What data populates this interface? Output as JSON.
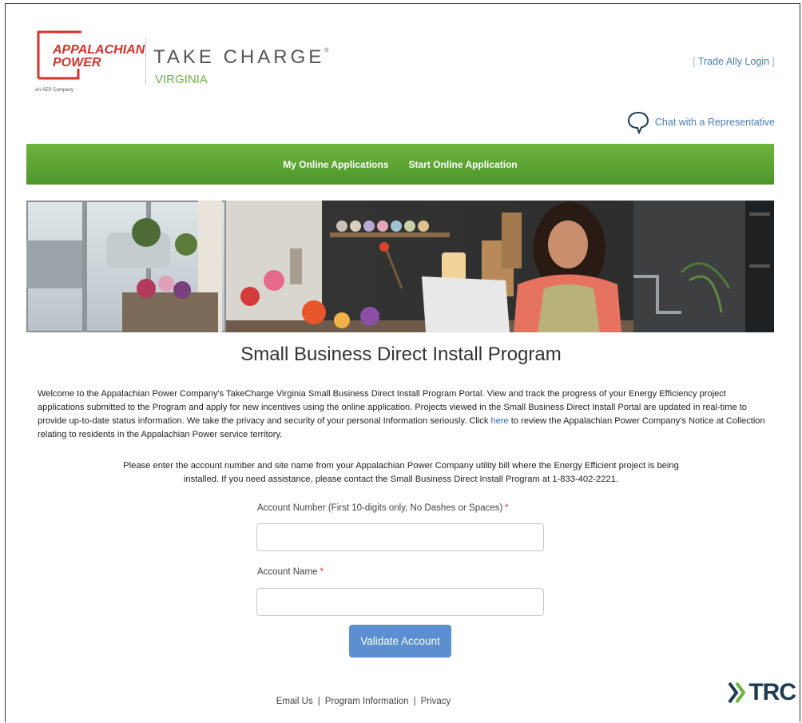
{
  "header": {
    "logo_line1": "APPALACHIAN",
    "logo_line2": "POWER",
    "logo_sub": "An AEP Company",
    "brand_title": "TAKE CHARGE",
    "brand_tm": "®",
    "brand_state": "VIRGINIA",
    "trade_ally_open": "[",
    "trade_ally_label": "Trade Ally Login",
    "trade_ally_close": "]",
    "chat_label": "Chat with a Representative"
  },
  "nav": {
    "items": [
      {
        "label": "My Online Applications"
      },
      {
        "label": "Start Online Application"
      }
    ]
  },
  "main": {
    "title": "Small Business Direct Install Program",
    "intro_before_link": "Welcome to the Appalachian Power Company's TakeCharge Virginia Small Business Direct Install Program Portal. View and track the progress of your Energy Efficiency project applications submitted to the Program and apply for new incentives using the online application. Projects viewed in the Small Business Direct Install Portal are updated in real-time to provide up-to-date status information. We take the privacy and security of your personal Information seriously. Click ",
    "intro_link": "here",
    "intro_after_link": " to review the Appalachian Power Company's Notice at Collection relating to residents in the Appalachian Power service territory.",
    "instructions": "Please enter the account number and site name from your Appalachian Power Company utility bill where the Energy Efficient project is being installed. If you need assistance, please contact the Small Business Direct Install Program at 1-833-402-2221."
  },
  "form": {
    "account_number_label": "Account Number (First 10-digits only, No Dashes or Spaces)",
    "account_number_value": "",
    "account_name_label": "Account Name",
    "account_name_value": "",
    "required_mark": "*",
    "validate_label": "Validate Account"
  },
  "footer": {
    "links": [
      "Email Us",
      "Program Information",
      "Privacy"
    ],
    "separator": "|",
    "partner_logo": "TRC"
  },
  "colors": {
    "brand_red": "#d9312b",
    "brand_green": "#6db33f",
    "nav_green": "#5aa534",
    "link_blue": "#4a7fb8",
    "button_blue": "#5b8fcf"
  },
  "icons": {
    "chat": "speech-bubble-icon",
    "trc": "trc-chevron-icon"
  }
}
